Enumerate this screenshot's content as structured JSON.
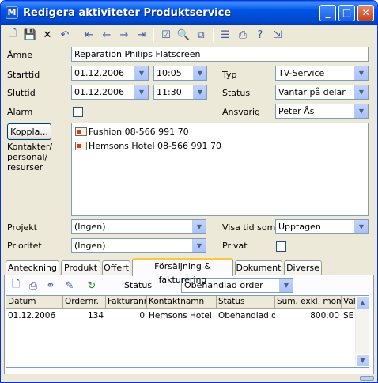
{
  "window": {
    "title": "Redigera aktiviteter Produktservice",
    "app_icon": "M"
  },
  "toolbar": {
    "icons": [
      "new-icon",
      "save-icon",
      "delete-icon",
      "undo-icon",
      "first-icon",
      "previous-icon",
      "next-icon",
      "last-icon",
      "check-icon",
      "preview-icon",
      "copy-icon",
      "properties-icon",
      "print-icon",
      "help-icon",
      "exit-icon"
    ]
  },
  "form": {
    "subject_label": "Ämne",
    "subject_value": "Reparation Philips Flatscreen",
    "start_label": "Starttid",
    "start_date": "01.12.2006",
    "start_time": "10:05",
    "end_label": "Sluttid",
    "end_date": "01.12.2006",
    "end_time": "11:30",
    "alarm_label": "Alarm",
    "type_label": "Typ",
    "type_value": "TV-Service",
    "status_label": "Status",
    "status_value": "Väntar på delar",
    "responsible_label": "Ansvarig",
    "responsible_value": "Peter Ås",
    "link_button": "Koppla...",
    "contacts_label": "Kontakter/ personal/ resurser",
    "contacts": [
      {
        "text": "Fushion 08-566 991 70"
      },
      {
        "text": "Hemsons Hotel 08-566 991 70"
      }
    ],
    "project_label": "Projekt",
    "project_value": "(Ingen)",
    "show_time_label": "Visa tid som",
    "show_time_value": "Upptagen",
    "priority_label": "Prioritet",
    "priority_value": "(Ingen)",
    "private_label": "Privat"
  },
  "tabs": [
    {
      "label": "Anteckning"
    },
    {
      "label": "Produkt"
    },
    {
      "label": "Offert"
    },
    {
      "label": "Försäljning & fakturering"
    },
    {
      "label": "Dokument"
    },
    {
      "label": "Diverse"
    }
  ],
  "sales": {
    "status_label": "Status",
    "status_value": "Obehandlad order",
    "columns": [
      "Datum",
      "Ordernr.",
      "Fakturanr.",
      "Kontaktnamn",
      "Status",
      "Sum. exkl. moms",
      "Valu"
    ],
    "rows": [
      [
        "01.12.2006",
        "134",
        "0",
        "Hemsons Hotel",
        "Obehandlad order",
        "800,00",
        "SE"
      ]
    ]
  }
}
